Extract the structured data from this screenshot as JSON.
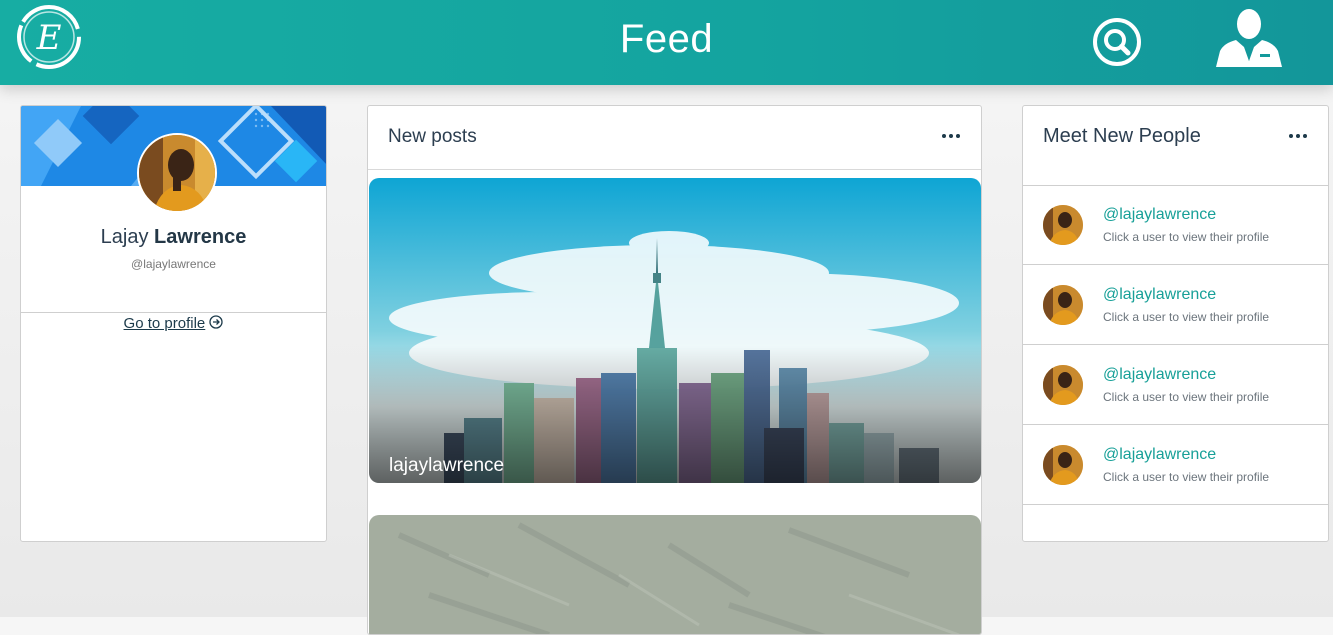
{
  "header": {
    "title": "Feed",
    "logo_letter": "E",
    "icons": [
      "search-icon",
      "user-icon"
    ],
    "accent_color": "#17ada3"
  },
  "profile": {
    "first_name": "Lajay",
    "last_name": "Lawrence",
    "handle": "@lajaylawrence",
    "link_label": "Go to profile"
  },
  "posts": {
    "title": "New posts",
    "items": [
      {
        "caption": "lajaylawrence"
      },
      {
        "caption": ""
      }
    ]
  },
  "people": {
    "title": "Meet New People",
    "items": [
      {
        "handle": "@lajaylawrence",
        "hint": "Click a user to view their profile"
      },
      {
        "handle": "@lajaylawrence",
        "hint": "Click a user to view their profile"
      },
      {
        "handle": "@lajaylawrence",
        "hint": "Click a user to view their profile"
      },
      {
        "handle": "@lajaylawrence",
        "hint": "Click a user to view their profile"
      }
    ]
  }
}
